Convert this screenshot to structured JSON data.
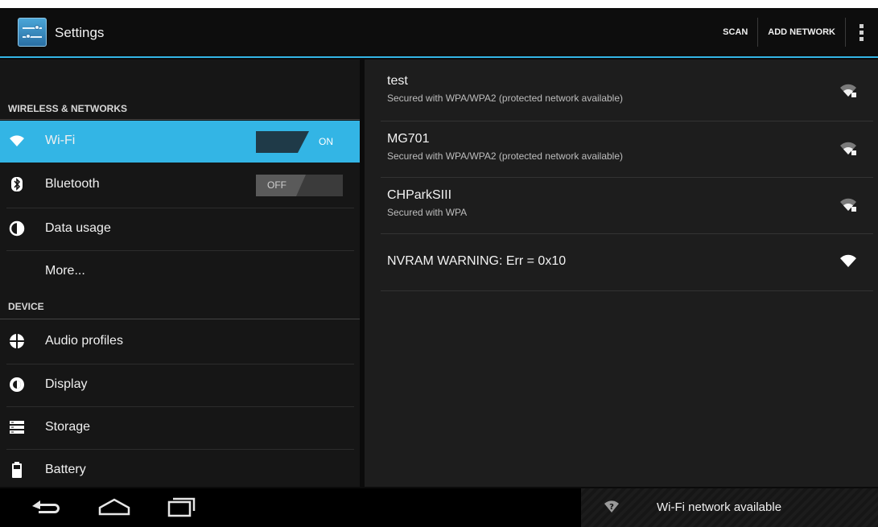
{
  "app": {
    "title": "Settings"
  },
  "actionbar": {
    "scan_label": "SCAN",
    "add_network_label": "ADD NETWORK"
  },
  "sections": {
    "wireless_header": "WIRELESS & NETWORKS",
    "device_header": "DEVICE"
  },
  "settings_items": {
    "wifi": {
      "label": "Wi-Fi",
      "toggle": "ON"
    },
    "bluetooth": {
      "label": "Bluetooth",
      "toggle": "OFF"
    },
    "data_usage": {
      "label": "Data usage"
    },
    "more": {
      "label": "More..."
    },
    "audio_profiles": {
      "label": "Audio profiles"
    },
    "display": {
      "label": "Display"
    },
    "storage": {
      "label": "Storage"
    },
    "battery": {
      "label": "Battery"
    }
  },
  "networks": [
    {
      "name": "test",
      "status": "Secured with WPA/WPA2 (protected network available)",
      "icon": "wifi-locked-icon"
    },
    {
      "name": "MG701",
      "status": "Secured with WPA/WPA2 (protected network available)",
      "icon": "wifi-locked-icon"
    },
    {
      "name": "CHParkSIII",
      "status": "Secured with WPA",
      "icon": "wifi-locked-icon"
    },
    {
      "name": "NVRAM WARNING: Err = 0x10",
      "status": "",
      "icon": "wifi-open-icon"
    }
  ],
  "notification": {
    "text": "Wi-Fi network available",
    "icon": "wifi-question-icon"
  },
  "colors": {
    "accent": "#33b5e5",
    "background": "#0b0b0b",
    "panel_left": "#161616",
    "panel_right": "#1d1d1d"
  }
}
